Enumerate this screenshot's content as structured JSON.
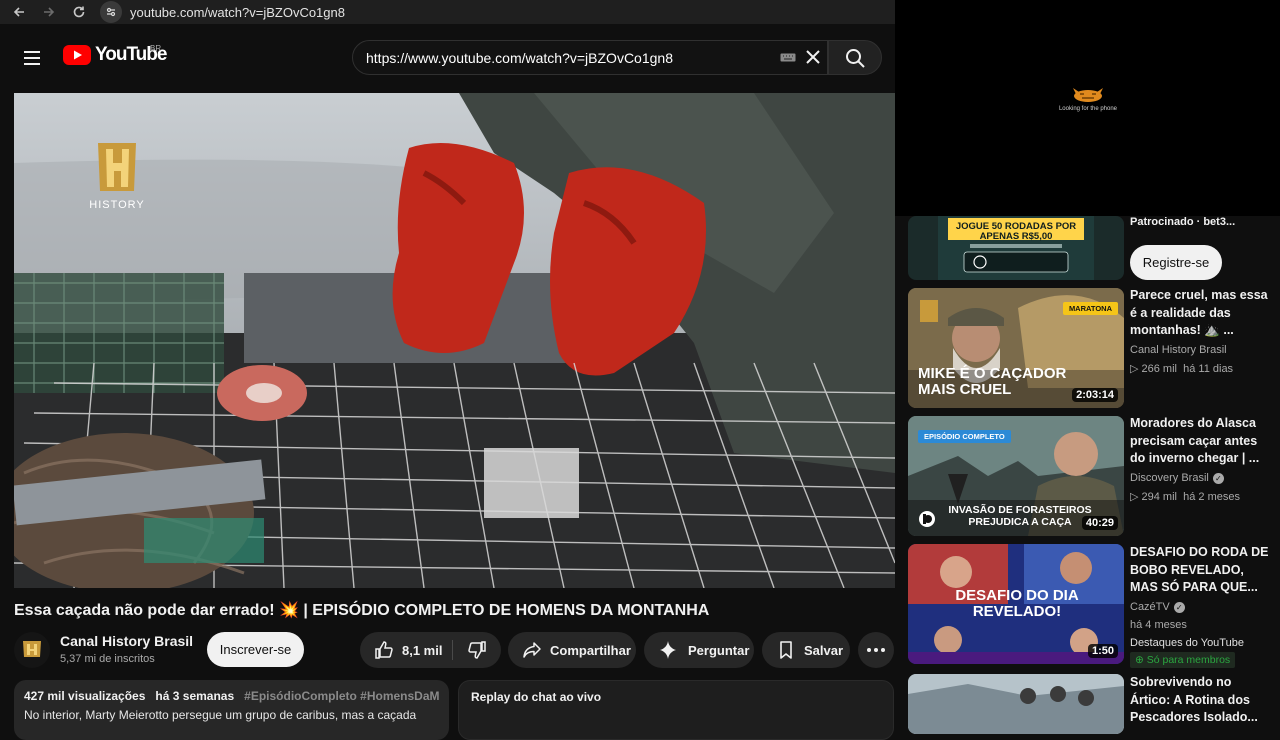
{
  "browser": {
    "url": "youtube.com/watch?v=jBZOvCo1gn8"
  },
  "header": {
    "logo_text": "YouTube",
    "country_code": "BR",
    "search_value": "https://www.youtube.com/watch?v=jBZOvCo1gn8"
  },
  "mini_player": {
    "caption": "Looking for the phone"
  },
  "video": {
    "watermark": "HISTORY",
    "title": "⁣Essa caçada não pode dar errado! 💥 | EPISÓDIO COMPLETO DE HOMENS DA MONTANHA"
  },
  "channel": {
    "name": "Canal History Brasil",
    "subscribers": "5,37 mi de inscritos",
    "subscribe_label": "Inscrever-se"
  },
  "actions": {
    "likes": "8,1 mil",
    "share": "Compartilhar",
    "ask": "Perguntar",
    "save": "Salvar"
  },
  "description": {
    "views": "427 mil visualizações",
    "age": "há 3 semanas",
    "tags": "#EpisódioCompleto #HomensDaM",
    "text": "No interior, Marty Meierotto persegue um grupo de caribus, mas a caçada"
  },
  "chat": {
    "label": "Replay do chat ao vivo"
  },
  "sidebar": {
    "ad": {
      "thumb_text": "JOGUE 50 RODADAS POR APENAS R$5,00",
      "sponsored": "Patrocinado · bet3...",
      "cta": "Registre-se"
    },
    "items": [
      {
        "title": "⁣Parece cruel, mas essa é a realidade das montanhas! ⛰️ ...",
        "channel": "Canal History Brasil",
        "views": "266 mil",
        "age": "há 11 dias",
        "duration": "2:03:14",
        "badge": "MARATONA",
        "thumb_caption": "MIKE É O CAÇADOR MAIS CRUEL"
      },
      {
        "title": "Moradores do Alasca precisam caçar antes do inverno chegar | ...",
        "channel": "Discovery Brasil",
        "views": "294 mil",
        "age": "há 2 meses",
        "duration": "40:29",
        "badge": "EPISÓDIO COMPLETO",
        "thumb_caption": "INVASÃO DE FORASTEIROS PREJUDICA A CAÇA"
      },
      {
        "title": "DESAFIO DO RODA DE BOBO REVELADO, MAS SÓ PARA QUE...",
        "channel": "CazéTV",
        "age": "há 4 meses",
        "extra": "Destaques do YouTube",
        "members": "Só para membros",
        "duration": "1:50",
        "thumb_caption": "DESAFIO DO DIA REVELADO!"
      },
      {
        "title": "Sobrevivendo no Ártico: A Rotina dos Pescadores Isolado..."
      }
    ]
  }
}
